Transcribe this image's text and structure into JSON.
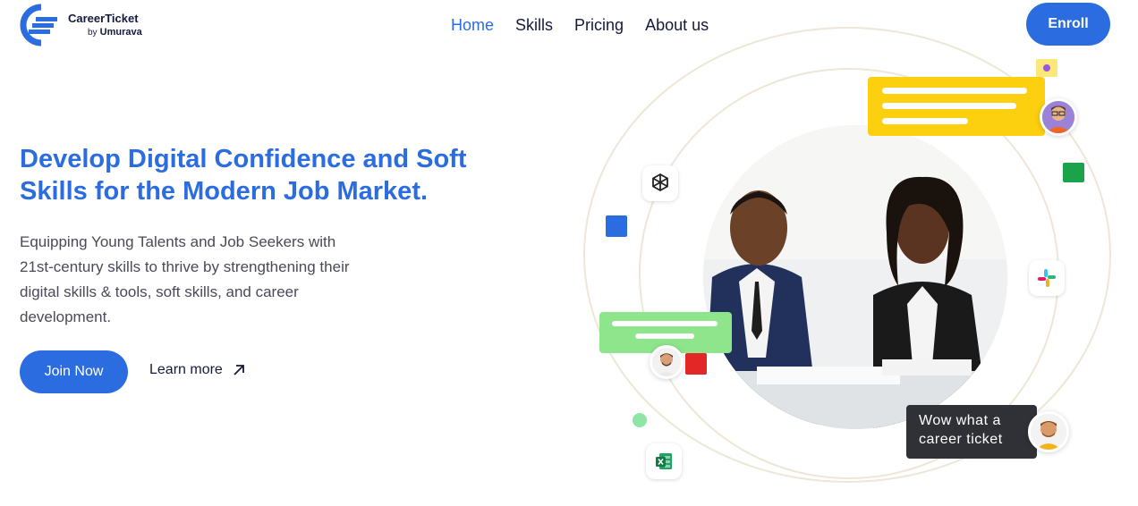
{
  "brand": {
    "name": "CareerTicket",
    "by": "by",
    "company": "Umurava",
    "color": "#2b6de0"
  },
  "nav": {
    "items": [
      {
        "label": "Home",
        "active": true
      },
      {
        "label": "Skills",
        "active": false
      },
      {
        "label": "Pricing",
        "active": false
      },
      {
        "label": "About us",
        "active": false
      }
    ],
    "enroll_label": "Enroll"
  },
  "hero": {
    "title_line1": "Develop Digital Confidence and Soft",
    "title_line2": "Skills for the Modern Job Market.",
    "desc_line1": "Equipping Young Talents and Job Seekers with",
    "desc_line2": "21st-century skills to thrive by strengthening their",
    "desc_line3": "digital skills & tools, soft skills, and career",
    "desc_line4": "development.",
    "join_label": "Join Now",
    "learn_label": "Learn more"
  },
  "illustration": {
    "comment_line1": "Wow what a",
    "comment_line2": "career ticket",
    "icons": [
      "openai-icon",
      "slack-icon",
      "excel-icon"
    ],
    "colors": {
      "yellow": "#fccf0f",
      "green": "#8ee58c",
      "blue": "#2b6de0",
      "red": "#e32626",
      "dark_green": "#1aa34a"
    }
  }
}
